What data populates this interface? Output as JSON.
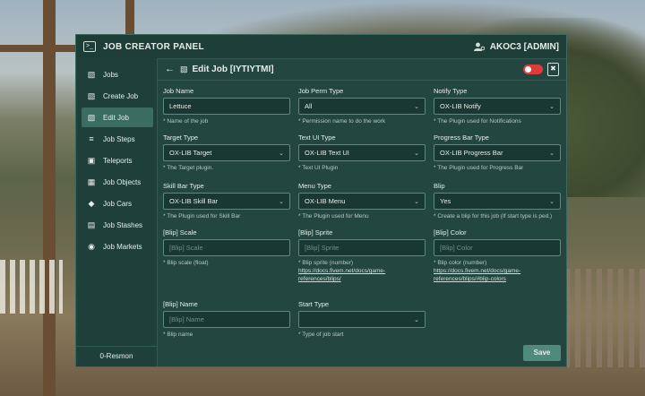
{
  "window": {
    "title": "JOB CREATOR PANEL",
    "user": "AKOC3 [ADMIN]"
  },
  "sidebar": {
    "items": [
      {
        "label": "Jobs",
        "icon": "database-icon"
      },
      {
        "label": "Create Job",
        "icon": "database-icon"
      },
      {
        "label": "Edit Job",
        "icon": "database-icon",
        "active": true
      },
      {
        "label": "Job Steps",
        "icon": "list-icon"
      },
      {
        "label": "Teleports",
        "icon": "monitor-icon"
      },
      {
        "label": "Job Objects",
        "icon": "objects-icon"
      },
      {
        "label": "Job Cars",
        "icon": "car-icon"
      },
      {
        "label": "Job Stashes",
        "icon": "stash-icon"
      },
      {
        "label": "Job Markets",
        "icon": "cart-icon"
      }
    ],
    "footer": "0-Resmon"
  },
  "header": {
    "title": "Edit Job [IYTIYTMI]"
  },
  "fields": {
    "job_name": {
      "label": "Job Name",
      "value": "Lettuce",
      "hint": "* Name of the job"
    },
    "job_perm_type": {
      "label": "Job Perm Type",
      "value": "All",
      "hint": "* Permission name to do the work"
    },
    "notify_type": {
      "label": "Notify Type",
      "value": "OX-LIB Notify",
      "hint": "* The Plugin used for Notifications"
    },
    "target_type": {
      "label": "Target Type",
      "value": "OX-LIB Target",
      "hint": "* The Target plugin."
    },
    "text_ui_type": {
      "label": "Text UI Type",
      "value": "OX-LIB Text UI",
      "hint": "* Text UI Plugin"
    },
    "progress_bar_type": {
      "label": "Progress Bar Type",
      "value": "OX-LIB Progress Bar",
      "hint": "* The Plugin used for Progress Bar"
    },
    "skill_bar_type": {
      "label": "Skill Bar Type",
      "value": "OX-LIB Skill Bar",
      "hint": "* The Plugin used for Skill Bar"
    },
    "menu_type": {
      "label": "Menu Type",
      "value": "OX-LIB Menu",
      "hint": "* The Plugin used for Menu"
    },
    "blip": {
      "label": "Blip",
      "value": "Yes",
      "hint": "* Create a blip for this job (If start type is ped.)"
    },
    "blip_scale": {
      "label": "[Blip] Scale",
      "placeholder": "[Blip] Scale",
      "hint": "* Blip scale (float)"
    },
    "blip_sprite": {
      "label": "[Blip] Sprite",
      "placeholder": "[Blip] Sprite",
      "hint": "* Blip sprite (number)",
      "link1": "https://docs.fivem.net/docs/game-",
      "link2": "references/blips/"
    },
    "blip_color": {
      "label": "[Blip] Color",
      "placeholder": "[Blip] Color",
      "hint": "* Blip color (number)",
      "link1": "https://docs.fivem.net/docs/game-",
      "link2": "references/blips/#blip-colors"
    },
    "blip_name": {
      "label": "[Blip] Name",
      "placeholder": "[Blip] Name",
      "hint": "* Blip name"
    },
    "start_type": {
      "label": "Start Type",
      "value": "",
      "hint": "* Type of job start"
    }
  },
  "actions": {
    "save_label": "Save"
  },
  "colors": {
    "panel": "#234640",
    "accent": "#4f8a7a",
    "toggle_off": "#e03a3a"
  }
}
